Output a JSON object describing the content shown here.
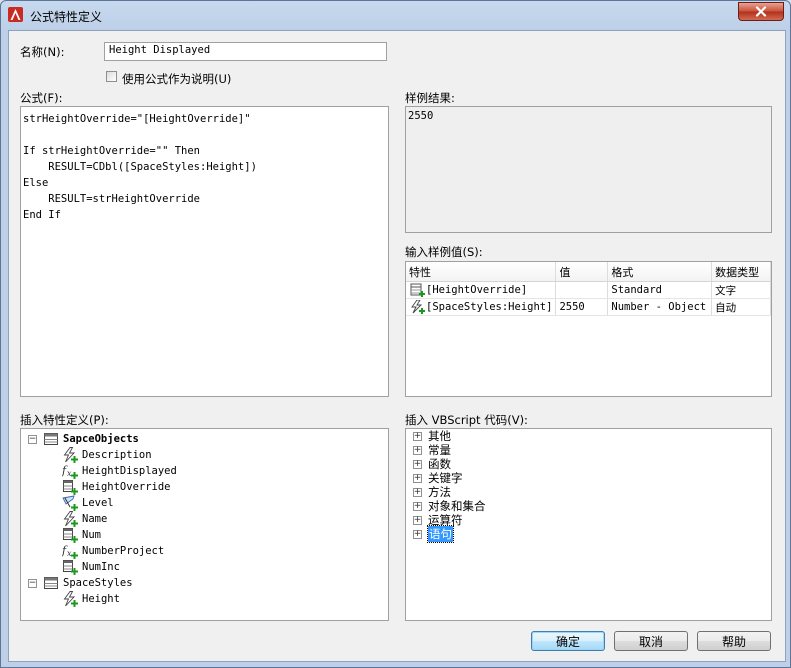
{
  "window": {
    "title": "公式特性定义"
  },
  "name_field": {
    "label": "名称(N):",
    "value": "Height Displayed"
  },
  "use_formula_checkbox": {
    "label": "使用公式作为说明(U)",
    "checked": false
  },
  "formula": {
    "label": "公式(F):",
    "text": "strHeightOverride=\"[HeightOverride]\"\n\nIf strHeightOverride=\"\" Then\n    RESULT=CDbl([SpaceStyles:Height])\nElse\n    RESULT=strHeightOverride\nEnd If"
  },
  "sample_result": {
    "label": "样例结果:",
    "value": "2550"
  },
  "sample_values": {
    "label": "输入样例值(S):",
    "columns": [
      "特性",
      "值",
      "格式",
      "数据类型"
    ],
    "rows": [
      {
        "icon": "table-add-icon",
        "property": "[HeightOverride]",
        "value": "",
        "format": "Standard",
        "type": "文字"
      },
      {
        "icon": "lightning-add-icon",
        "property": "[SpaceStyles:Height]",
        "value": "2550",
        "format": "Number - Object",
        "type": "自动"
      }
    ]
  },
  "insert_property": {
    "label": "插入特性定义(P):",
    "tree": [
      {
        "text": "SapceObjects",
        "level": 0,
        "expander": "−",
        "icon": "table-icon",
        "bold": true
      },
      {
        "text": "Description",
        "level": 1,
        "icon": "lightning-add-icon"
      },
      {
        "text": "HeightDisplayed",
        "level": 1,
        "icon": "fx-add-icon"
      },
      {
        "text": "HeightOverride",
        "level": 1,
        "icon": "table-add-icon"
      },
      {
        "text": "Level",
        "level": 1,
        "icon": "location-add-icon"
      },
      {
        "text": "Name",
        "level": 1,
        "icon": "lightning-add-icon"
      },
      {
        "text": "Num",
        "level": 1,
        "icon": "table-add-icon"
      },
      {
        "text": "NumberProject",
        "level": 1,
        "icon": "fx-add-icon"
      },
      {
        "text": "NumInc",
        "level": 1,
        "icon": "table-add-icon"
      },
      {
        "text": "SpaceStyles",
        "level": 0,
        "expander": "−",
        "icon": "table-icon",
        "bold": false
      },
      {
        "text": "Height",
        "level": 1,
        "icon": "lightning-add-icon"
      }
    ]
  },
  "insert_vbscript": {
    "label": "插入 VBScript 代码(V):",
    "tree": [
      {
        "text": "其他",
        "expander": "+"
      },
      {
        "text": "常量",
        "expander": "+"
      },
      {
        "text": "函数",
        "expander": "+"
      },
      {
        "text": "关键字",
        "expander": "+"
      },
      {
        "text": "方法",
        "expander": "+"
      },
      {
        "text": "对象和集合",
        "expander": "+"
      },
      {
        "text": "运算符",
        "expander": "+"
      },
      {
        "text": "语句",
        "expander": "+",
        "selected": true
      }
    ]
  },
  "buttons": {
    "ok": "确定",
    "cancel": "取消",
    "help": "帮助"
  },
  "colors": {
    "accent": "#3399ff",
    "title_bar": "#c7d9ee",
    "close_button": "#c8503a"
  }
}
